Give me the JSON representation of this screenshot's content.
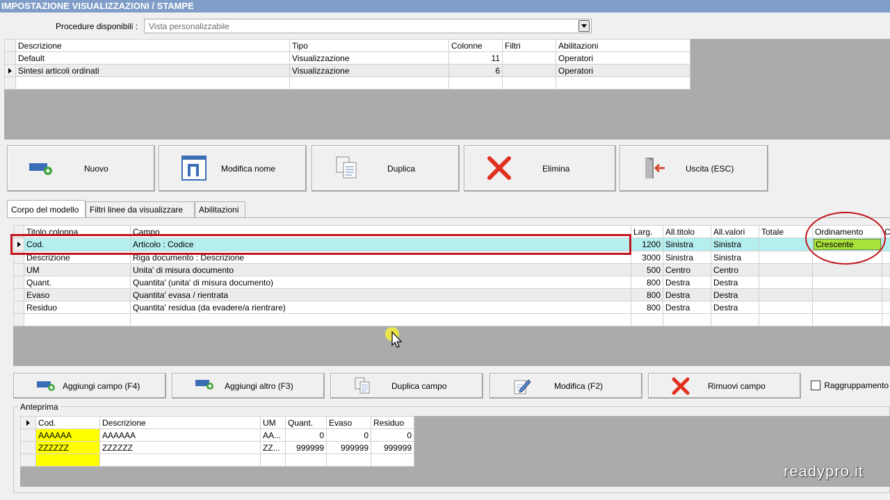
{
  "window": {
    "title": "IMPOSTAZIONE VISUALIZZAZIONI / STAMPE"
  },
  "procedure": {
    "label": "Procedure disponibili :",
    "value": "Vista personalizzabile"
  },
  "views_grid": {
    "columns": [
      "Descrizione",
      "Tipo",
      "Colonne",
      "Filtri",
      "Abilitazioni"
    ],
    "rows": [
      {
        "descrizione": "Default",
        "tipo": "Visualizzazione",
        "colonne": "11",
        "filtri": "",
        "abilitazioni": "Operatori"
      },
      {
        "descrizione": "Sintesi articoli ordinati",
        "tipo": "Visualizzazione",
        "colonne": "6",
        "filtri": "",
        "abilitazioni": "Operatori"
      }
    ]
  },
  "toolbar": {
    "nuovo": "Nuovo",
    "modifica_nome": "Modifica nome",
    "duplica": "Duplica",
    "elimina": "Elimina",
    "uscita": "Uscita (ESC)"
  },
  "tabs": [
    "Corpo del modello",
    "Filtri linee da visualizzare",
    "Abilitazioni"
  ],
  "fields_grid": {
    "columns": [
      "Titolo colonna",
      "Campo",
      "Larg.",
      "All.titolo",
      "All.valori",
      "Totale",
      "Ordinamento",
      "C"
    ],
    "rows": [
      {
        "titolo": "Cod.",
        "campo": "Articolo : Codice",
        "larg": "1200",
        "all_titolo": "Sinistra",
        "all_valori": "Sinistra",
        "totale": "",
        "ordinamento": "Crescente"
      },
      {
        "titolo": "Descrizione",
        "campo": "Riga documento : Descrizione",
        "larg": "3000",
        "all_titolo": "Sinistra",
        "all_valori": "Sinistra",
        "totale": "",
        "ordinamento": ""
      },
      {
        "titolo": "UM",
        "campo": "Unita' di misura documento",
        "larg": "500",
        "all_titolo": "Centro",
        "all_valori": "Centro",
        "totale": "",
        "ordinamento": ""
      },
      {
        "titolo": "Quant.",
        "campo": "Quantita' (unita' di misura documento)",
        "larg": "800",
        "all_titolo": "Destra",
        "all_valori": "Destra",
        "totale": "",
        "ordinamento": ""
      },
      {
        "titolo": "Evaso",
        "campo": "Quantita' evasa / rientrata",
        "larg": "800",
        "all_titolo": "Destra",
        "all_valori": "Destra",
        "totale": "",
        "ordinamento": ""
      },
      {
        "titolo": "Residuo",
        "campo": "Quantita' residua (da evadere/a rientrare)",
        "larg": "800",
        "all_titolo": "Destra",
        "all_valori": "Destra",
        "totale": "",
        "ordinamento": ""
      }
    ]
  },
  "field_buttons": {
    "aggiungi_campo": "Aggiungi campo (F4)",
    "aggiungi_altro": "Aggiungi altro (F3)",
    "duplica_campo": "Duplica campo",
    "modifica": "Modifica (F2)",
    "rimuovi_campo": "Rimuovi campo",
    "raggruppamento": "Raggruppamento"
  },
  "preview": {
    "legend": "Anteprima",
    "columns": [
      "Cod.",
      "Descrizione",
      "UM",
      "Quant.",
      "Evaso",
      "Residuo"
    ],
    "rows": [
      {
        "cod": "AAAAAA",
        "descrizione": "AAAAAA",
        "um": "AA...",
        "quant": "0",
        "evaso": "0",
        "residuo": "0"
      },
      {
        "cod": "ZZZZZZ",
        "descrizione": "ZZZZZZ",
        "um": "ZZ...",
        "quant": "999999",
        "evaso": "999999",
        "residuo": "999999"
      }
    ]
  },
  "watermark": "readypro.it",
  "colors": {
    "title_bar": "#7f9dc8",
    "selected_row": "#b4eeee",
    "sort_highlight": "#a8e23a",
    "preview_code": "#ffff00",
    "annotation_red": "#c0141c"
  },
  "icons": {
    "nuovo": "add-card-icon",
    "modifica_nome": "rename-n-icon",
    "duplica": "copy-document-icon",
    "elimina": "red-x-icon",
    "uscita": "exit-door-icon",
    "modifica": "edit-pencil-icon"
  }
}
